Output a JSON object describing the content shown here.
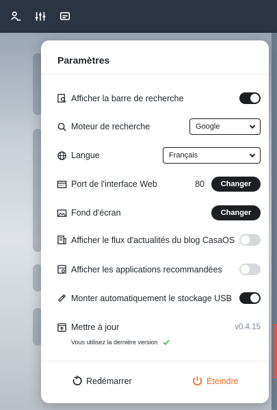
{
  "topbar": {
    "icons": [
      "user-icon",
      "sliders-icon",
      "widget-icon"
    ]
  },
  "panel": {
    "title": "Paramètres",
    "rows": {
      "search_bar": {
        "label": "Afficher la barre de recherche",
        "enabled": true,
        "icon": "search-box-icon"
      },
      "search_engine": {
        "label": "Moteur de recherche",
        "value": "Google",
        "icon": "search-icon"
      },
      "language": {
        "label": "Langue",
        "value": "Français",
        "icon": "globe-icon"
      },
      "web_port": {
        "label": "Port de l'interface Web",
        "port": "80",
        "button": "Changer",
        "icon": "http-icon"
      },
      "wallpaper": {
        "label": "Fond d'écran",
        "button": "Changer",
        "icon": "image-icon"
      },
      "blog_feed": {
        "label": "Afficher le flux d'actualités du blog CasaOS",
        "enabled": false,
        "icon": "news-icon"
      },
      "recommended_apps": {
        "label": "Afficher les applications recommandées",
        "enabled": false,
        "icon": "apps-icon"
      },
      "usb_mount": {
        "label": "Monter automatiquement le stockage USB",
        "enabled": true,
        "icon": "usb-icon"
      },
      "update": {
        "label": "Mettre à jour",
        "version": "v0.4.15",
        "note": "Vous utilisez la dernière version",
        "icon": "update-icon"
      }
    },
    "footer": {
      "restart": "Redémarrer",
      "shutdown": "Éteindre"
    }
  },
  "colors": {
    "accent_dark": "#1d1f22",
    "shutdown": "#f06a1d",
    "check": "#3bb54a"
  }
}
